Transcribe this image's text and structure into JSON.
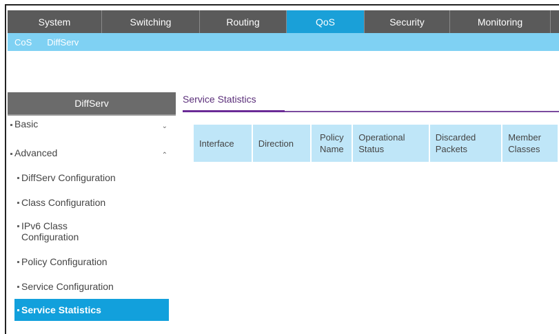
{
  "topnav": {
    "tabs": [
      {
        "label": "System",
        "active": false
      },
      {
        "label": "Switching",
        "active": false
      },
      {
        "label": "Routing",
        "active": false
      },
      {
        "label": "QoS",
        "active": true
      },
      {
        "label": "Security",
        "active": false
      },
      {
        "label": "Monitoring",
        "active": false
      }
    ]
  },
  "subnav": {
    "items": [
      "CoS",
      "DiffServ"
    ]
  },
  "sidebar": {
    "header": "DiffServ",
    "groups": [
      {
        "label": "Basic",
        "expanded": false
      },
      {
        "label": "Advanced",
        "expanded": true
      }
    ],
    "items": [
      {
        "label": "DiffServ Configuration"
      },
      {
        "label": "Class Configuration"
      },
      {
        "label": "IPv6 Class Configuration",
        "line1": "IPv6 Class",
        "line2": "Configuration"
      },
      {
        "label": "Policy Configuration"
      },
      {
        "label": "Service Configuration"
      },
      {
        "label": "Service Statistics",
        "active": true
      }
    ]
  },
  "main": {
    "title": "Service Statistics",
    "table": {
      "columns": [
        {
          "l1": "Interface",
          "l2": ""
        },
        {
          "l1": "Direction",
          "l2": ""
        },
        {
          "l1": "Policy",
          "l2": "Name"
        },
        {
          "l1": "Operational",
          "l2": "Status"
        },
        {
          "l1": "Discarded",
          "l2": "Packets"
        },
        {
          "l1": "Member",
          "l2": "Classes"
        }
      ]
    }
  },
  "colors": {
    "nav_bg": "#5a5a5a",
    "active_tab": "#1aa0d8",
    "subnav_bg": "#7fd1f3",
    "sidebar_active": "#12a0dc",
    "title_accent": "#6a2a96",
    "table_header": "#bfe6f8"
  }
}
